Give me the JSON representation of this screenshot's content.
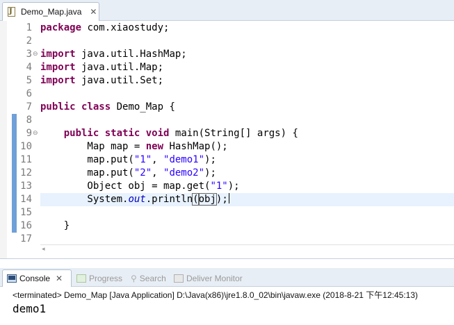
{
  "editor_tab": {
    "label": "Demo_Map.java",
    "close": "✕",
    "icon": "java-file-icon"
  },
  "code": {
    "lines": [
      {
        "n": "1",
        "fold": "",
        "scope": false,
        "current": false
      },
      {
        "n": "2",
        "fold": "",
        "scope": false,
        "current": false
      },
      {
        "n": "3",
        "fold": "⊖",
        "scope": false,
        "current": false
      },
      {
        "n": "4",
        "fold": "",
        "scope": false,
        "current": false
      },
      {
        "n": "5",
        "fold": "",
        "scope": false,
        "current": false
      },
      {
        "n": "6",
        "fold": "",
        "scope": false,
        "current": false
      },
      {
        "n": "7",
        "fold": "",
        "scope": false,
        "current": false
      },
      {
        "n": "8",
        "fold": "",
        "scope": true,
        "current": false
      },
      {
        "n": "9",
        "fold": "⊖",
        "scope": true,
        "current": false
      },
      {
        "n": "10",
        "fold": "",
        "scope": true,
        "current": false
      },
      {
        "n": "11",
        "fold": "",
        "scope": true,
        "current": false
      },
      {
        "n": "12",
        "fold": "",
        "scope": true,
        "current": false
      },
      {
        "n": "13",
        "fold": "",
        "scope": true,
        "current": false
      },
      {
        "n": "14",
        "fold": "",
        "scope": true,
        "current": true
      },
      {
        "n": "15",
        "fold": "",
        "scope": true,
        "current": false
      },
      {
        "n": "16",
        "fold": "",
        "scope": true,
        "current": false
      },
      {
        "n": "17",
        "fold": "",
        "scope": false,
        "current": false
      }
    ],
    "tokens": {
      "l1_kw": "package",
      "l1_rest": " com.xiaostudy;",
      "l3_kw": "import",
      "l3_rest": " java.util.HashMap;",
      "l4_kw": "import",
      "l4_rest": " java.util.Map;",
      "l5_kw": "import",
      "l5_rest": " java.util.Set;",
      "l7_kw1": "public",
      "l7_sp": " ",
      "l7_kw2": "class",
      "l7_rest": " Demo_Map {",
      "l9_indent": "    ",
      "l9_kw1": "public",
      "l9_kw2": "static",
      "l9_kw3": "void",
      "l9_rest": " main(String[] args) {",
      "l10_a": "        Map map = ",
      "l10_kw": "new",
      "l10_b": " HashMap();",
      "l11_a": "        map.put(",
      "l11_s1": "\"1\"",
      "l11_b": ", ",
      "l11_s2": "\"demo1\"",
      "l11_c": ");",
      "l12_a": "        map.put(",
      "l12_s1": "\"2\"",
      "l12_b": ", ",
      "l12_s2": "\"demo2\"",
      "l12_c": ");",
      "l13_a": "        Object obj = map.get(",
      "l13_s1": "\"1\"",
      "l13_b": ");",
      "l14_a": "        System.",
      "l14_fld": "out",
      "l14_b": ".println",
      "l14_p1": "(",
      "l14_obj": "obj",
      "l14_p2": ")",
      "l14_c": ";",
      "l16_a": "    }"
    },
    "scroll_left": "◂"
  },
  "console": {
    "tabs": [
      {
        "label": "Console",
        "icon": "console-monitor-icon",
        "close": "✕",
        "active": true
      },
      {
        "label": "Progress",
        "icon": "progress-icon",
        "active": false
      },
      {
        "label": "Search",
        "icon": "search-icon",
        "active": false
      },
      {
        "label": "Deliver Monitor",
        "icon": "deliver-monitor-icon",
        "active": false
      }
    ],
    "status": "<terminated> Demo_Map [Java Application] D:\\Java(x86)\\jre1.8.0_02\\bin\\javaw.exe (2018-8-21 下午12:45:13)",
    "output": "demo1"
  },
  "colors": {
    "keyword": "#7f0055",
    "string": "#2a00ff",
    "field": "#0000c0",
    "current_line": "#e8f2fe",
    "scope_bar": "#6fa0d8"
  }
}
